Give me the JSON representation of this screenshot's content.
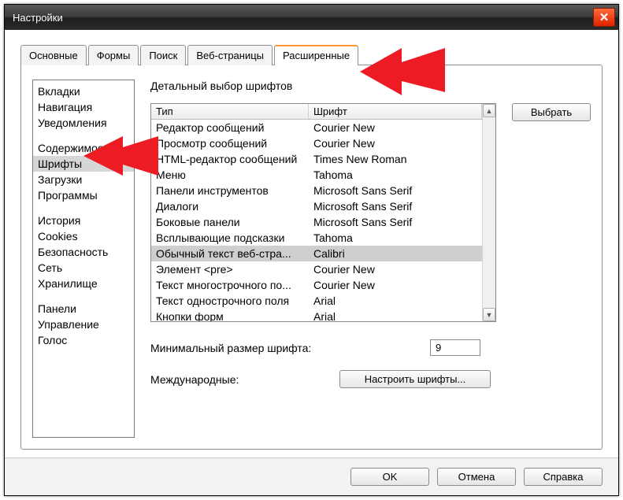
{
  "window": {
    "title": "Настройки"
  },
  "tabs": [
    "Основные",
    "Формы",
    "Поиск",
    "Веб-страницы",
    "Расширенные"
  ],
  "active_tab_index": 4,
  "sidebar_groups": [
    [
      "Вкладки",
      "Навигация",
      "Уведомления"
    ],
    [
      "Содержимое",
      "Шрифты",
      "Загрузки",
      "Программы"
    ],
    [
      "История",
      "Cookies",
      "Безопасность",
      "Сеть",
      "Хранилище"
    ],
    [
      "Панели",
      "Управление",
      "Голос"
    ]
  ],
  "sidebar_selected": "Шрифты",
  "section_title": "Детальный выбор шрифтов",
  "columns": {
    "type": "Тип",
    "font": "Шрифт"
  },
  "rows": [
    {
      "type": "Редактор сообщений",
      "font": "Courier New"
    },
    {
      "type": "Просмотр сообщений",
      "font": "Courier New"
    },
    {
      "type": "HTML-редактор сообщений",
      "font": "Times New Roman"
    },
    {
      "type": "Меню",
      "font": "Tahoma"
    },
    {
      "type": "Панели инструментов",
      "font": "Microsoft Sans Serif"
    },
    {
      "type": "Диалоги",
      "font": "Microsoft Sans Serif"
    },
    {
      "type": "Боковые панели",
      "font": "Microsoft Sans Serif"
    },
    {
      "type": "Всплывающие подсказки",
      "font": "Tahoma"
    },
    {
      "type": "Обычный текст веб-стра...",
      "font": "Calibri"
    },
    {
      "type": "Элемент <pre>",
      "font": "Courier New"
    },
    {
      "type": "Текст многострочного по...",
      "font": "Courier New"
    },
    {
      "type": "Текст однострочного поля",
      "font": "Arial"
    },
    {
      "type": "Кнопки форм",
      "font": "Arial"
    }
  ],
  "selected_row_index": 8,
  "buttons": {
    "choose": "Выбрать",
    "intl": "Настроить шрифты...",
    "ok": "OK",
    "cancel": "Отмена",
    "help": "Справка"
  },
  "labels": {
    "min_font": "Минимальный размер шрифта:",
    "intl": "Международные:"
  },
  "values": {
    "min_font": "9"
  },
  "colors": {
    "accent_tab": "#ff9a2e",
    "arrow": "#ed1c24"
  }
}
